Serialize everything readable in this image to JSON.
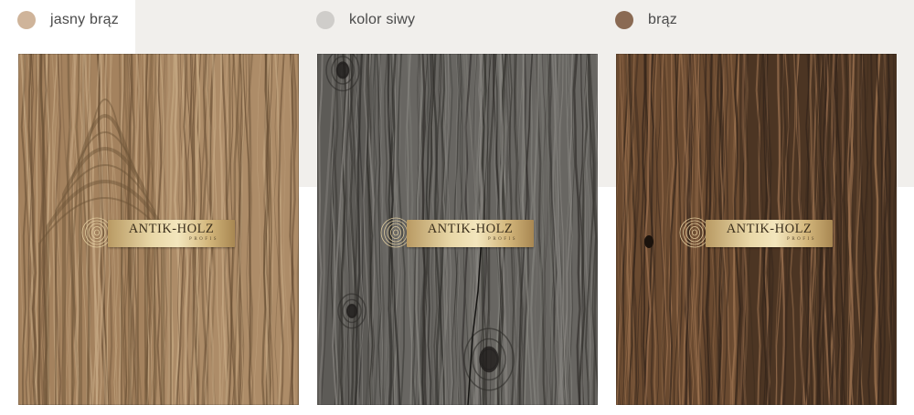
{
  "swatches": [
    {
      "label": "jasny brąz",
      "color": "#cfb49a"
    },
    {
      "label": "kolor siwy",
      "color": "#cfcdca"
    },
    {
      "label": "brąz",
      "color": "#8a6a53"
    }
  ],
  "panels": [
    {
      "name": "light-brown",
      "base": "#a4825e",
      "dark": "#6b5136",
      "light": "#c8ab86"
    },
    {
      "name": "grey",
      "base": "#5d5b57",
      "dark": "#2f2d2a",
      "light": "#8a8883"
    },
    {
      "name": "brown",
      "base": "#6a4a30",
      "dark": "#33241a",
      "light": "#a07552"
    }
  ],
  "logo": {
    "text": "ANTIK-HOLZ",
    "subtext": "PROFIS"
  }
}
